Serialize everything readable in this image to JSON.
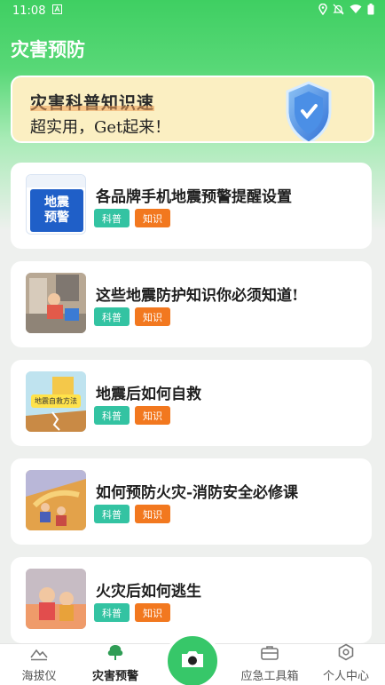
{
  "status": {
    "time": "11:08",
    "icons": [
      "notification-a-icon",
      "location-icon",
      "mute-icon",
      "wifi-icon",
      "battery-icon"
    ]
  },
  "app": {
    "title": "灾害预防"
  },
  "banner": {
    "title": "灾害科普知识速",
    "subtitle": "超实用，Get起来！",
    "icon": "shield-icon"
  },
  "articles": [
    {
      "title": "各品牌手机地震预警提醒设置",
      "tags": [
        "科普",
        "知识"
      ],
      "thumb_text": [
        "地震",
        "预警"
      ]
    },
    {
      "title": "这些地震防护知识你必须知道!",
      "tags": [
        "科普",
        "知识"
      ]
    },
    {
      "title": "地震后如何自救",
      "tags": [
        "科普",
        "知识"
      ],
      "thumb_text": [
        "地震自救方法"
      ]
    },
    {
      "title": "如何预防火灾-消防安全必修课",
      "tags": [
        "科普",
        "知识"
      ]
    },
    {
      "title": "火灾后如何逃生",
      "tags": [
        "科普",
        "知识"
      ]
    }
  ],
  "nav": {
    "items": [
      {
        "label": "海拔仪",
        "icon": "mountain-icon"
      },
      {
        "label": "灾害预警",
        "icon": "tree-icon"
      },
      {
        "label": "",
        "icon": "camera-icon"
      },
      {
        "label": "应急工具箱",
        "icon": "toolbox-icon"
      },
      {
        "label": "个人中心",
        "icon": "profile-icon"
      }
    ],
    "active_index": 1
  },
  "colors": {
    "primary": "#3fcf62",
    "tag_science": "#33c3a2",
    "tag_knowledge": "#f2781f",
    "banner_bg": "#fbefc2"
  }
}
